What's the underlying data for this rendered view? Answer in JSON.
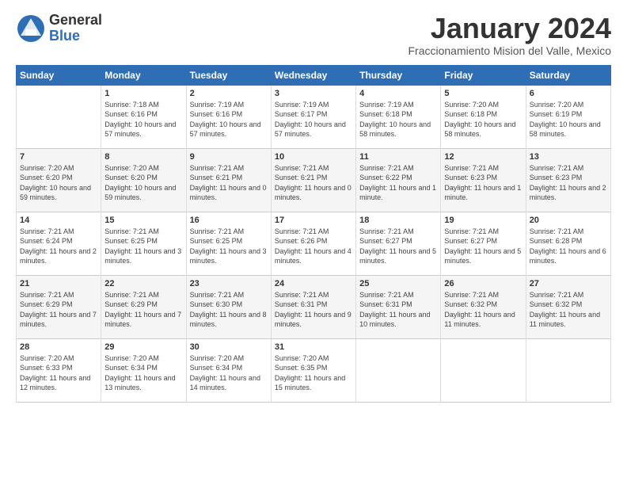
{
  "header": {
    "logo_general": "General",
    "logo_blue": "Blue",
    "month_title": "January 2024",
    "location": "Fraccionamiento Mision del Valle, Mexico"
  },
  "weekdays": [
    "Sunday",
    "Monday",
    "Tuesday",
    "Wednesday",
    "Thursday",
    "Friday",
    "Saturday"
  ],
  "weeks": [
    [
      {
        "day": "",
        "sunrise": "",
        "sunset": "",
        "daylight": ""
      },
      {
        "day": "1",
        "sunrise": "Sunrise: 7:18 AM",
        "sunset": "Sunset: 6:16 PM",
        "daylight": "Daylight: 10 hours and 57 minutes."
      },
      {
        "day": "2",
        "sunrise": "Sunrise: 7:19 AM",
        "sunset": "Sunset: 6:16 PM",
        "daylight": "Daylight: 10 hours and 57 minutes."
      },
      {
        "day": "3",
        "sunrise": "Sunrise: 7:19 AM",
        "sunset": "Sunset: 6:17 PM",
        "daylight": "Daylight: 10 hours and 57 minutes."
      },
      {
        "day": "4",
        "sunrise": "Sunrise: 7:19 AM",
        "sunset": "Sunset: 6:18 PM",
        "daylight": "Daylight: 10 hours and 58 minutes."
      },
      {
        "day": "5",
        "sunrise": "Sunrise: 7:20 AM",
        "sunset": "Sunset: 6:18 PM",
        "daylight": "Daylight: 10 hours and 58 minutes."
      },
      {
        "day": "6",
        "sunrise": "Sunrise: 7:20 AM",
        "sunset": "Sunset: 6:19 PM",
        "daylight": "Daylight: 10 hours and 58 minutes."
      }
    ],
    [
      {
        "day": "7",
        "sunrise": "Sunrise: 7:20 AM",
        "sunset": "Sunset: 6:20 PM",
        "daylight": "Daylight: 10 hours and 59 minutes."
      },
      {
        "day": "8",
        "sunrise": "Sunrise: 7:20 AM",
        "sunset": "Sunset: 6:20 PM",
        "daylight": "Daylight: 10 hours and 59 minutes."
      },
      {
        "day": "9",
        "sunrise": "Sunrise: 7:21 AM",
        "sunset": "Sunset: 6:21 PM",
        "daylight": "Daylight: 11 hours and 0 minutes."
      },
      {
        "day": "10",
        "sunrise": "Sunrise: 7:21 AM",
        "sunset": "Sunset: 6:21 PM",
        "daylight": "Daylight: 11 hours and 0 minutes."
      },
      {
        "day": "11",
        "sunrise": "Sunrise: 7:21 AM",
        "sunset": "Sunset: 6:22 PM",
        "daylight": "Daylight: 11 hours and 1 minute."
      },
      {
        "day": "12",
        "sunrise": "Sunrise: 7:21 AM",
        "sunset": "Sunset: 6:23 PM",
        "daylight": "Daylight: 11 hours and 1 minute."
      },
      {
        "day": "13",
        "sunrise": "Sunrise: 7:21 AM",
        "sunset": "Sunset: 6:23 PM",
        "daylight": "Daylight: 11 hours and 2 minutes."
      }
    ],
    [
      {
        "day": "14",
        "sunrise": "Sunrise: 7:21 AM",
        "sunset": "Sunset: 6:24 PM",
        "daylight": "Daylight: 11 hours and 2 minutes."
      },
      {
        "day": "15",
        "sunrise": "Sunrise: 7:21 AM",
        "sunset": "Sunset: 6:25 PM",
        "daylight": "Daylight: 11 hours and 3 minutes."
      },
      {
        "day": "16",
        "sunrise": "Sunrise: 7:21 AM",
        "sunset": "Sunset: 6:25 PM",
        "daylight": "Daylight: 11 hours and 3 minutes."
      },
      {
        "day": "17",
        "sunrise": "Sunrise: 7:21 AM",
        "sunset": "Sunset: 6:26 PM",
        "daylight": "Daylight: 11 hours and 4 minutes."
      },
      {
        "day": "18",
        "sunrise": "Sunrise: 7:21 AM",
        "sunset": "Sunset: 6:27 PM",
        "daylight": "Daylight: 11 hours and 5 minutes."
      },
      {
        "day": "19",
        "sunrise": "Sunrise: 7:21 AM",
        "sunset": "Sunset: 6:27 PM",
        "daylight": "Daylight: 11 hours and 5 minutes."
      },
      {
        "day": "20",
        "sunrise": "Sunrise: 7:21 AM",
        "sunset": "Sunset: 6:28 PM",
        "daylight": "Daylight: 11 hours and 6 minutes."
      }
    ],
    [
      {
        "day": "21",
        "sunrise": "Sunrise: 7:21 AM",
        "sunset": "Sunset: 6:29 PM",
        "daylight": "Daylight: 11 hours and 7 minutes."
      },
      {
        "day": "22",
        "sunrise": "Sunrise: 7:21 AM",
        "sunset": "Sunset: 6:29 PM",
        "daylight": "Daylight: 11 hours and 7 minutes."
      },
      {
        "day": "23",
        "sunrise": "Sunrise: 7:21 AM",
        "sunset": "Sunset: 6:30 PM",
        "daylight": "Daylight: 11 hours and 8 minutes."
      },
      {
        "day": "24",
        "sunrise": "Sunrise: 7:21 AM",
        "sunset": "Sunset: 6:31 PM",
        "daylight": "Daylight: 11 hours and 9 minutes."
      },
      {
        "day": "25",
        "sunrise": "Sunrise: 7:21 AM",
        "sunset": "Sunset: 6:31 PM",
        "daylight": "Daylight: 11 hours and 10 minutes."
      },
      {
        "day": "26",
        "sunrise": "Sunrise: 7:21 AM",
        "sunset": "Sunset: 6:32 PM",
        "daylight": "Daylight: 11 hours and 11 minutes."
      },
      {
        "day": "27",
        "sunrise": "Sunrise: 7:21 AM",
        "sunset": "Sunset: 6:32 PM",
        "daylight": "Daylight: 11 hours and 11 minutes."
      }
    ],
    [
      {
        "day": "28",
        "sunrise": "Sunrise: 7:20 AM",
        "sunset": "Sunset: 6:33 PM",
        "daylight": "Daylight: 11 hours and 12 minutes."
      },
      {
        "day": "29",
        "sunrise": "Sunrise: 7:20 AM",
        "sunset": "Sunset: 6:34 PM",
        "daylight": "Daylight: 11 hours and 13 minutes."
      },
      {
        "day": "30",
        "sunrise": "Sunrise: 7:20 AM",
        "sunset": "Sunset: 6:34 PM",
        "daylight": "Daylight: 11 hours and 14 minutes."
      },
      {
        "day": "31",
        "sunrise": "Sunrise: 7:20 AM",
        "sunset": "Sunset: 6:35 PM",
        "daylight": "Daylight: 11 hours and 15 minutes."
      },
      {
        "day": "",
        "sunrise": "",
        "sunset": "",
        "daylight": ""
      },
      {
        "day": "",
        "sunrise": "",
        "sunset": "",
        "daylight": ""
      },
      {
        "day": "",
        "sunrise": "",
        "sunset": "",
        "daylight": ""
      }
    ]
  ]
}
